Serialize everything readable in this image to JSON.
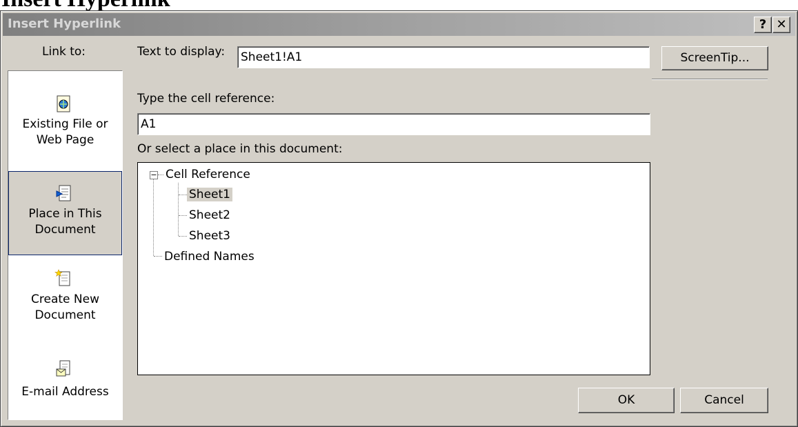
{
  "page_heading": "Insert Hyperlink",
  "window": {
    "title": "Insert Hyperlink",
    "help_button": "?",
    "close_button": "✕"
  },
  "link_to": {
    "label": "Link to:",
    "items": [
      {
        "line1": "Existing File or",
        "line2": "Web Page",
        "icon": "web-page-icon",
        "selected": false
      },
      {
        "line1": "Place in This",
        "line2": "Document",
        "icon": "document-place-icon",
        "selected": true
      },
      {
        "line1": "Create New",
        "line2": "Document",
        "icon": "new-document-icon",
        "selected": false
      },
      {
        "line1": "E-mail Address",
        "line2": "",
        "icon": "email-icon",
        "selected": false
      }
    ]
  },
  "text_to_display": {
    "label": "Text to display:",
    "value": "Sheet1!A1"
  },
  "screentip_button": "ScreenTip...",
  "cell_reference": {
    "label": "Type the cell reference:",
    "value": "A1"
  },
  "place_list": {
    "label": "Or select a place in this document:",
    "tree": {
      "root": "Cell Reference",
      "children": [
        "Sheet1",
        "Sheet2",
        "Sheet3"
      ],
      "selected": "Sheet1",
      "second_root": "Defined Names",
      "expander": "−"
    }
  },
  "ok_button": "OK",
  "cancel_button": "Cancel",
  "colors": {
    "dialog_bg": "#d4d0c8",
    "selection_border": "#0a246a"
  }
}
